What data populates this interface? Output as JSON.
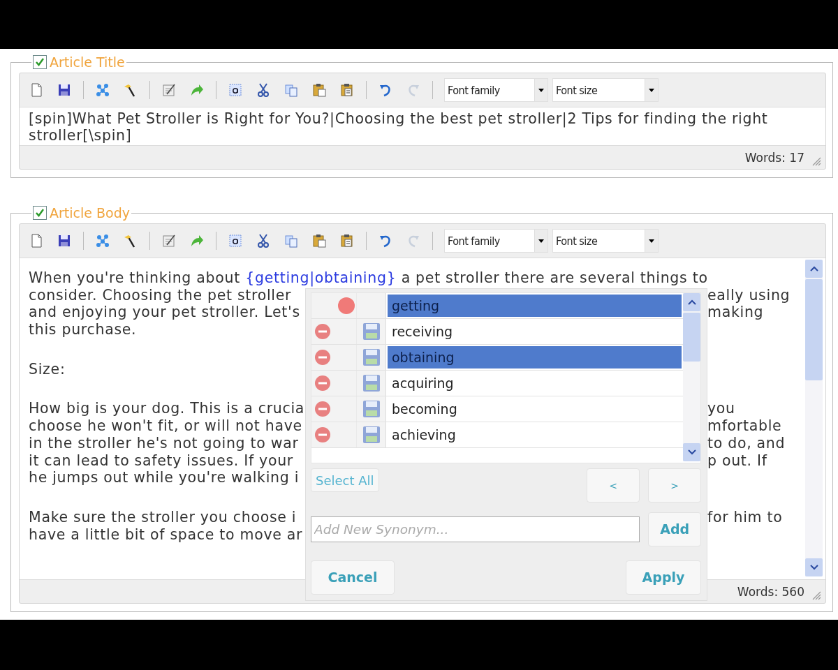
{
  "editors": [
    {
      "legend": "Article Title",
      "checked": true,
      "selects": [
        {
          "label": "Font family"
        },
        {
          "label": "Font size"
        }
      ],
      "kind": "plain",
      "text": "[spin]What Pet Stroller is Right for You?|Choosing the best pet stroller|2 Tips for finding the right stroller[\\spin]",
      "words": "Words: 17"
    },
    {
      "legend": "Article Body",
      "checked": true,
      "selects": [
        {
          "label": "Font family"
        },
        {
          "label": "Font size"
        }
      ],
      "kind": "rich",
      "paragraphs": [
        {
          "lines": [
            {
              "parts": [
                {
                  "text": "When you're thinking about ",
                  "kind": "plain"
                },
                {
                  "text": "{getting|obtaining}",
                  "kind": "spin"
                },
                {
                  "text": " a pet stroller there are several things to",
                  "kind": "plain"
                }
              ]
            },
            {
              "left": "consider. Choosing the pet stroller",
              "right": "eally using"
            },
            {
              "left": "and enjoying your pet stroller. Let's",
              "right": "making"
            },
            {
              "left": "this purchase."
            }
          ]
        },
        {
          "lines": [
            {
              "left": "Size:"
            }
          ]
        },
        {
          "lines": [
            {
              "left": "How big is your dog. This is a crucia",
              "right": "you"
            },
            {
              "left": "choose he won't fit, or will not have",
              "right": "mfortable"
            },
            {
              "left": "in the stroller he's not going to war",
              "right": "to do, and"
            },
            {
              "left": "it can lead to safety issues. If your",
              "right": "p out. If"
            },
            {
              "left": "he jumps out while you're walking i"
            }
          ]
        },
        {
          "lines": [
            {
              "left": "Make sure the stroller you choose i",
              "right": "for him to"
            },
            {
              "left": "have a little bit of space to move ar"
            }
          ]
        }
      ],
      "words": "Words: 560",
      "popup": {
        "synonyms": [
          {
            "word": "getting",
            "kind": "current",
            "selected": true
          },
          {
            "word": "receiving",
            "kind": "synonym",
            "selected": false
          },
          {
            "word": "obtaining",
            "kind": "synonym",
            "selected": true
          },
          {
            "word": "acquiring",
            "kind": "synonym",
            "selected": false
          },
          {
            "word": "becoming",
            "kind": "synonym",
            "selected": false
          },
          {
            "word": "achieving",
            "kind": "synonym",
            "selected": false
          }
        ],
        "select_all": "Select All",
        "prev": "<",
        "next": ">",
        "new_synonym": {
          "placeholder": "Add New Synonym..."
        },
        "add": "Add",
        "cancel": "Cancel",
        "apply": "Apply"
      }
    }
  ]
}
